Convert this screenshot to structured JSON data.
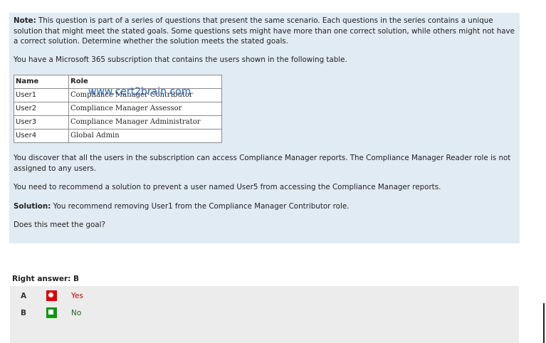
{
  "question": {
    "note_label": "Note:",
    "note_text": " This question is part of a series of questions that present the same scenario. Each questions in the series contains a unique solution that might meet the stated goals. Some questions sets might have more than one correct solution, while others might not have a correct solution. Determine whether the solution meets the stated goals.",
    "intro": "You have a Microsoft 365 subscription that contains the users shown in the following table.",
    "table": {
      "headers": [
        "Name",
        "Role"
      ],
      "rows": [
        [
          "User1",
          "Compliance Manager Contributor"
        ],
        [
          "User2",
          "Compliance Manager Assessor"
        ],
        [
          "User3",
          "Compliance Manager Administrator"
        ],
        [
          "User4",
          "Global Admin"
        ]
      ]
    },
    "watermark": "www.cert2brain.com",
    "discover": "You discover that all the users in the subscription can access Compliance Manager reports. The Compliance Manager Reader role is not assigned to any users.",
    "need": "You need to recommend a solution to prevent a user named User5 from accessing the Compliance Manager reports.",
    "solution_label": "Solution:",
    "solution_text": " You recommend removing User1 from the Compliance Manager Contributor role.",
    "ask": "Does this meet the goal?"
  },
  "answer": {
    "label": "Right answer: B"
  },
  "options": [
    {
      "letter": "A",
      "text": "Yes",
      "color": "#e00000",
      "text_color": "#c00000"
    },
    {
      "letter": "B",
      "text": "No",
      "color": "#119611",
      "text_color": "#226622"
    }
  ]
}
